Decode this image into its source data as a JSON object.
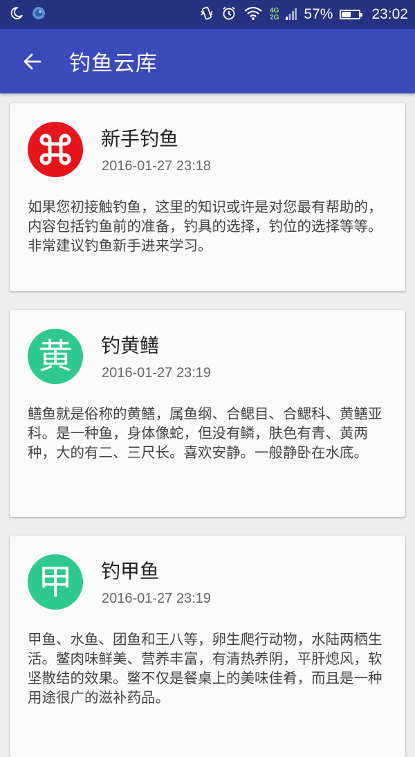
{
  "status_bar": {
    "battery_percent_text": "57%",
    "battery_level": 0.57,
    "network_4g": "4G",
    "network_2g": "2G",
    "time": "23:02",
    "icons": [
      "moon-icon",
      "app-notification-icon",
      "vibrate-icon",
      "alarm-icon",
      "wifi-icon",
      "signal-icon",
      "battery-icon"
    ]
  },
  "app_bar": {
    "title": "钓鱼云库",
    "back_icon": "arrow-left-icon"
  },
  "articles": [
    {
      "title": "新手钓鱼",
      "date": "2016-01-27 23:18",
      "description": "如果您初接触钓鱼，这里的知识或许是对您最有帮助的，内容包括钓鱼前的准备，钓具的选择，钓位的选择等等。非常建议钓鱼新手进来学习。",
      "avatar_color": "#e8141b",
      "avatar_icon": "command-key-icon"
    },
    {
      "title": "钓黄鳝",
      "date": "2016-01-27 23:19",
      "description": "鳝鱼就是俗称的黄鳝，属鱼纲、合鳃目、合鳃科、黄鳝亚科。是一种鱼，身体像蛇，但没有鳞，肤色有青、黄两种，大的有二、三尺长。喜欢安静。一般静卧在水底。",
      "avatar_color": "#2ec98f",
      "avatar_glyph": "黄"
    },
    {
      "title": "钓甲鱼",
      "date": "2016-01-27 23:19",
      "description": "甲鱼、水鱼、团鱼和王八等，卵生爬行动物，水陆两栖生活。鳖肉味鲜美、营养丰富，有清热养阴，平肝熄风，软坚散结的效果。鳖不仅是餐桌上的美味佳肴，而且是一种用途很广的滋补药品。",
      "avatar_color": "#2ec98f",
      "avatar_glyph": "甲"
    }
  ]
}
